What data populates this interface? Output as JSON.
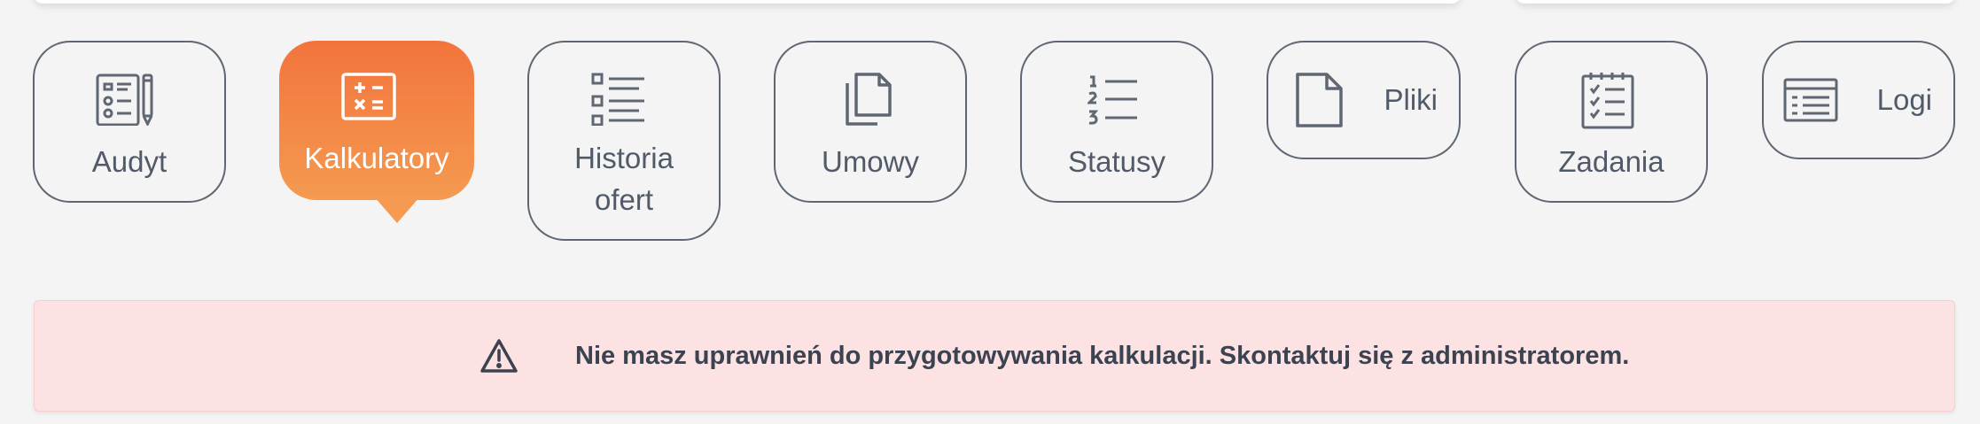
{
  "tabs": [
    {
      "id": "audit",
      "label": "Audyt",
      "icon": "audit-checklist-icon",
      "active": false
    },
    {
      "id": "calculators",
      "label": "Kalkulatory",
      "icon": "calculator-icon",
      "active": true
    },
    {
      "id": "offer-history",
      "label_line1": "Historia",
      "label_line2": "ofert",
      "icon": "list-icon",
      "active": false
    },
    {
      "id": "contracts",
      "label": "Umowy",
      "icon": "documents-icon",
      "active": false
    },
    {
      "id": "statuses",
      "label": "Statusy",
      "icon": "numbered-list-icon",
      "active": false
    },
    {
      "id": "files",
      "label": "Pliki",
      "icon": "file-icon",
      "active": false
    },
    {
      "id": "tasks",
      "label": "Zadania",
      "icon": "task-list-icon",
      "active": false
    },
    {
      "id": "logs",
      "label": "Logi",
      "icon": "log-table-icon",
      "active": false
    }
  ],
  "alert": {
    "icon": "warning-icon",
    "message": "Nie masz uprawnień do przygotowywania kalkulacji. Skontaktuj się z administratorem."
  },
  "colors": {
    "active_gradient_top": "#f2743c",
    "active_gradient_bottom": "#f59a50",
    "tab_border": "#5f6773",
    "tab_text": "#515a68",
    "alert_background": "#fde2e3",
    "alert_text": "#3b4250"
  }
}
